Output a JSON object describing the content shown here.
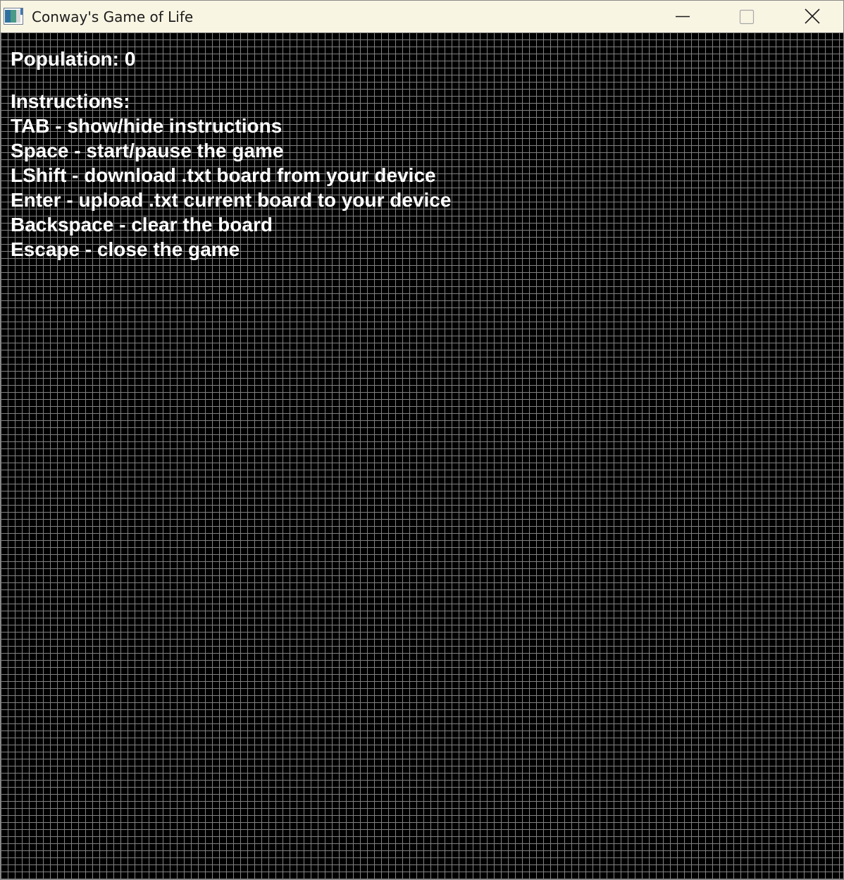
{
  "window": {
    "title": "Conway's Game of Life",
    "icon": "app-icon",
    "controls": {
      "minimize": "minimize-icon",
      "maximize": "maximize-icon",
      "close": "close-icon"
    }
  },
  "board": {
    "background_color": "#000000",
    "grid_color": "#808080",
    "cell_size_px": 10
  },
  "hud": {
    "population_label": "Population: 0",
    "instructions_title": "Instructions:",
    "instructions": [
      "TAB - show/hide instructions",
      "Space - start/pause the game",
      "LShift - download .txt board from your device",
      "Enter - upload .txt current board to your device",
      "Backspace - clear the board",
      "Escape - close the game"
    ]
  }
}
